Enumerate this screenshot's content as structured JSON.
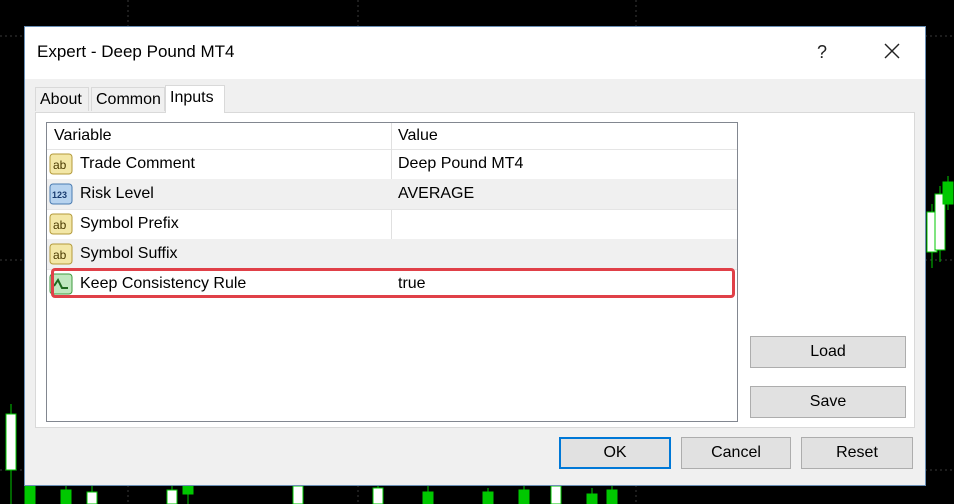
{
  "window": {
    "title": "Expert - Deep Pound MT4",
    "help_label": "?"
  },
  "tabs": [
    {
      "label": "About"
    },
    {
      "label": "Common"
    },
    {
      "label": "Inputs"
    }
  ],
  "active_tab": "Inputs",
  "grid": {
    "columns": [
      "Variable",
      "Value"
    ],
    "rows": [
      {
        "icon": "text-param-icon",
        "variable": "Trade Comment",
        "value": "Deep Pound MT4"
      },
      {
        "icon": "enum-param-icon",
        "variable": "Risk Level",
        "value": "AVERAGE"
      },
      {
        "icon": "text-param-icon",
        "variable": "Symbol Prefix",
        "value": ""
      },
      {
        "icon": "text-param-icon",
        "variable": "Symbol Suffix",
        "value": ""
      },
      {
        "icon": "bool-param-icon",
        "variable": "Keep Consistency Rule",
        "value": "true"
      }
    ],
    "highlighted_row": "Keep Consistency Rule"
  },
  "buttons": {
    "load": "Load",
    "save": "Save",
    "ok": "OK",
    "cancel": "Cancel",
    "reset": "Reset"
  },
  "colors": {
    "highlight_border": "#e04048",
    "chart_candle": "#00c800",
    "chart_bg": "#000000"
  }
}
